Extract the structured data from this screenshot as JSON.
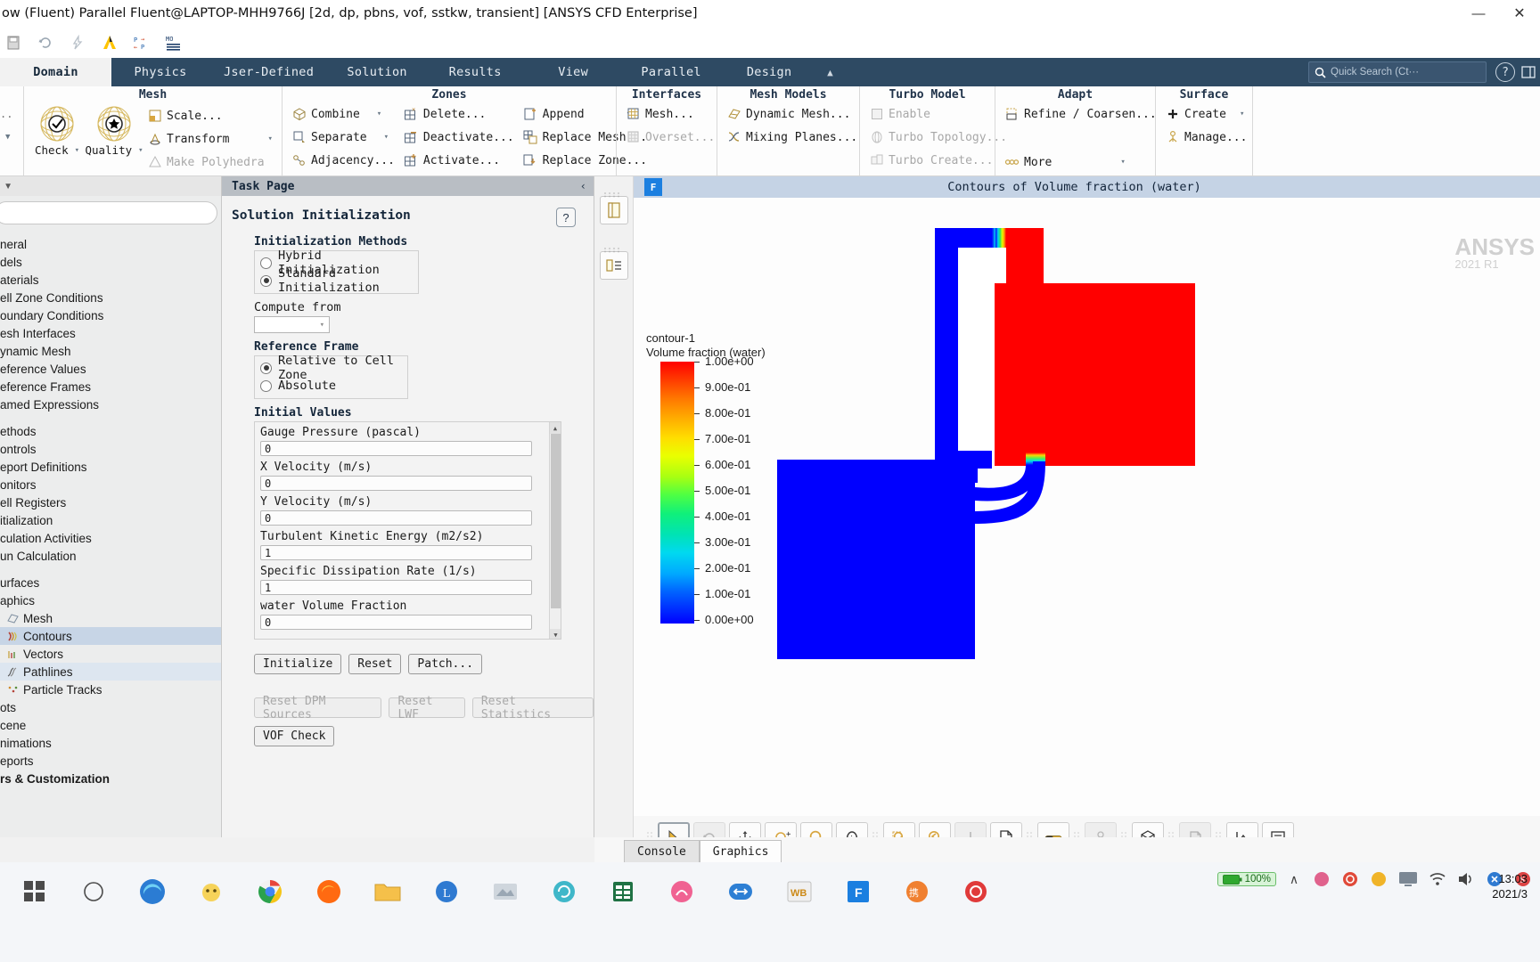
{
  "window": {
    "title": "ow (Fluent) Parallel Fluent@LAPTOP-MHH9766J  [2d, dp, pbns, vof, sstkw, transient] [ANSYS CFD Enterprise]",
    "minimize": "—",
    "maximize": "❐",
    "close": "✕"
  },
  "quick_access": [
    {
      "name": "save-icon",
      "glyph": "὚B"
    },
    {
      "name": "refresh-icon",
      "glyph": "↻"
    },
    {
      "name": "lightning-icon",
      "glyph": "⚡"
    },
    {
      "name": "ansys-logo-icon",
      "glyph": "Λ"
    },
    {
      "name": "pressure-icon",
      "glyph": "P"
    },
    {
      "name": "mo-icon",
      "glyph": "MO"
    }
  ],
  "ribbon": {
    "tabs": [
      {
        "label": "Domain",
        "active": true
      },
      {
        "label": "Physics",
        "active": false
      },
      {
        "label": "Jser-Defined",
        "active": false
      },
      {
        "label": "Solution",
        "active": false
      },
      {
        "label": "Results",
        "active": false
      },
      {
        "label": "View",
        "active": false
      },
      {
        "label": "Parallel",
        "active": false
      },
      {
        "label": "Design",
        "active": false
      }
    ],
    "collapse_caret": "▲",
    "search": {
      "placeholder": "Quick Search (Ct···",
      "icon": "search-icon"
    },
    "help_label": "?",
    "groups": [
      {
        "title": "Mesh",
        "big_buttons": [
          {
            "label": "Check",
            "caret": "▾",
            "icon": "mesh-check-icon"
          },
          {
            "label": "Quality",
            "caret": "▾",
            "icon": "mesh-quality-icon"
          }
        ],
        "items": [
          {
            "label": "Scale...",
            "icon": "scale-icon",
            "disabled": false,
            "caret": ""
          },
          {
            "label": "Transform",
            "icon": "transform-icon",
            "disabled": false,
            "caret": "▾"
          },
          {
            "label": "Make Polyhedra",
            "icon": "polyhedra-icon",
            "disabled": true,
            "caret": ""
          }
        ]
      },
      {
        "title": "Zones",
        "items_col1": [
          {
            "label": "Combine",
            "icon": "combine-icon",
            "disabled": false,
            "caret": "▾"
          },
          {
            "label": "Separate",
            "icon": "separate-icon",
            "disabled": false,
            "caret": "▾"
          },
          {
            "label": "Adjacency...",
            "icon": "adjacency-icon",
            "disabled": false,
            "caret": ""
          }
        ],
        "items_col2": [
          {
            "label": "Delete...",
            "icon": "delete-zone-icon",
            "disabled": false,
            "caret": ""
          },
          {
            "label": "Deactivate...",
            "icon": "deactivate-zone-icon",
            "disabled": false,
            "caret": ""
          },
          {
            "label": "Activate...",
            "icon": "activate-zone-icon",
            "disabled": false,
            "caret": ""
          }
        ],
        "items_col3": [
          {
            "label": "Append",
            "icon": "append-icon",
            "disabled": false,
            "caret": "▾"
          },
          {
            "label": "Replace Mesh...",
            "icon": "replace-mesh-icon",
            "disabled": false,
            "caret": ""
          },
          {
            "label": "Replace Zone...",
            "icon": "replace-zone-icon",
            "disabled": false,
            "caret": ""
          }
        ]
      },
      {
        "title": "Interfaces",
        "items": [
          {
            "label": "Mesh...",
            "icon": "interface-mesh-icon",
            "disabled": false,
            "caret": ""
          },
          {
            "label": "Overset...",
            "icon": "overset-icon",
            "disabled": true,
            "caret": ""
          }
        ]
      },
      {
        "title": "Mesh Models",
        "items": [
          {
            "label": "Dynamic Mesh...",
            "icon": "dynamic-mesh-icon",
            "disabled": false,
            "caret": ""
          },
          {
            "label": "Mixing Planes...",
            "icon": "mixing-planes-icon",
            "disabled": false,
            "caret": ""
          }
        ]
      },
      {
        "title": "Turbo Model",
        "items": [
          {
            "label": "Enable",
            "icon": "turbo-enable-icon",
            "disabled": true,
            "caret": ""
          },
          {
            "label": "Turbo Topology...",
            "icon": "turbo-topology-icon",
            "disabled": true,
            "caret": ""
          },
          {
            "label": "Turbo Create...",
            "icon": "turbo-create-icon",
            "disabled": true,
            "caret": ""
          }
        ]
      },
      {
        "title": "Adapt",
        "items": [
          {
            "label": "Refine / Coarsen...",
            "icon": "refine-coarsen-icon",
            "disabled": false,
            "caret": ""
          },
          {
            "label": "More",
            "icon": "more-icon",
            "disabled": false,
            "caret": "▾"
          }
        ]
      },
      {
        "title": "Surface",
        "items": [
          {
            "label": "Create",
            "icon": "create-surface-icon",
            "disabled": false,
            "caret": "▾"
          },
          {
            "label": "Manage...",
            "icon": "manage-surface-icon",
            "disabled": false,
            "caret": ""
          }
        ]
      }
    ]
  },
  "tree": {
    "items": [
      {
        "label": "neral",
        "icon": "",
        "state": "normal"
      },
      {
        "label": "dels",
        "icon": "",
        "state": "normal"
      },
      {
        "label": "aterials",
        "icon": "",
        "state": "normal"
      },
      {
        "label": "ell Zone Conditions",
        "icon": "",
        "state": "normal"
      },
      {
        "label": "oundary Conditions",
        "icon": "",
        "state": "normal"
      },
      {
        "label": "esh Interfaces",
        "icon": "",
        "state": "normal"
      },
      {
        "label": "ynamic Mesh",
        "icon": "",
        "state": "normal"
      },
      {
        "label": "eference Values",
        "icon": "",
        "state": "normal"
      },
      {
        "label": "eference Frames",
        "icon": "",
        "state": "normal"
      },
      {
        "label": "amed Expressions",
        "icon": "",
        "state": "normal"
      },
      {
        "label": "GAP",
        "icon": "",
        "state": "gap"
      },
      {
        "label": "ethods",
        "icon": "",
        "state": "normal"
      },
      {
        "label": "ontrols",
        "icon": "",
        "state": "normal"
      },
      {
        "label": "eport Definitions",
        "icon": "",
        "state": "normal"
      },
      {
        "label": "onitors",
        "icon": "",
        "state": "normal"
      },
      {
        "label": "ell Registers",
        "icon": "",
        "state": "normal"
      },
      {
        "label": "itialization",
        "icon": "",
        "state": "normal"
      },
      {
        "label": "culation Activities",
        "icon": "",
        "state": "normal"
      },
      {
        "label": "un Calculation",
        "icon": "",
        "state": "normal"
      },
      {
        "label": "GAP",
        "icon": "",
        "state": "gap"
      },
      {
        "label": "urfaces",
        "icon": "",
        "state": "normal"
      },
      {
        "label": "aphics",
        "icon": "",
        "state": "normal"
      },
      {
        "label": "Mesh",
        "icon": "mesh-tree-icon",
        "state": "child"
      },
      {
        "label": "Contours",
        "icon": "contours-tree-icon",
        "state": "selected"
      },
      {
        "label": "Vectors",
        "icon": "vectors-tree-icon",
        "state": "child"
      },
      {
        "label": "Pathlines",
        "icon": "pathlines-tree-icon",
        "state": "hover"
      },
      {
        "label": "Particle Tracks",
        "icon": "particle-tracks-tree-icon",
        "state": "child"
      },
      {
        "label": "ots",
        "icon": "",
        "state": "normal"
      },
      {
        "label": "cene",
        "icon": "",
        "state": "normal"
      },
      {
        "label": "nimations",
        "icon": "",
        "state": "normal"
      },
      {
        "label": "eports",
        "icon": "",
        "state": "normal"
      },
      {
        "label": "rs & Customization",
        "icon": "",
        "state": "bold"
      }
    ]
  },
  "task_page": {
    "header": "Task Page",
    "collapse_chevron": "‹",
    "title": "Solution Initialization",
    "help_label": "?",
    "init_methods": {
      "group_label": "Initialization Methods",
      "options": [
        {
          "label": "Hybrid  Initialization",
          "selected": false
        },
        {
          "label": "Standard Initialization",
          "selected": true
        }
      ]
    },
    "compute_from": {
      "label": "Compute from",
      "value": "",
      "caret": "▾"
    },
    "reference_frame": {
      "group_label": "Reference Frame",
      "options": [
        {
          "label": "Relative to Cell Zone",
          "selected": true
        },
        {
          "label": "Absolute",
          "selected": false
        }
      ]
    },
    "initial_values": {
      "group_label": "Initial Values",
      "fields": [
        {
          "label": "Gauge Pressure (pascal)",
          "value": "0"
        },
        {
          "label": "X Velocity (m/s)",
          "value": "0"
        },
        {
          "label": "Y Velocity (m/s)",
          "value": "0"
        },
        {
          "label": "Turbulent Kinetic Energy (m2/s2)",
          "value": "1"
        },
        {
          "label": "Specific Dissipation Rate (1/s)",
          "value": "1"
        },
        {
          "label": "water Volume Fraction",
          "value": "0"
        }
      ]
    },
    "buttons_primary": [
      {
        "label": "Initialize",
        "disabled": false
      },
      {
        "label": "Reset",
        "disabled": false
      },
      {
        "label": "Patch...",
        "disabled": false
      }
    ],
    "buttons_reset": [
      {
        "label": "Reset DPM Sources",
        "disabled": true
      },
      {
        "label": "Reset LWF",
        "disabled": true
      },
      {
        "label": "Reset Statistics",
        "disabled": true
      }
    ],
    "buttons_vof": [
      {
        "label": "VOF Check",
        "disabled": false
      }
    ]
  },
  "graphics": {
    "tag": "F",
    "title": "Contours of Volume fraction (water)",
    "watermark": "ANSYS",
    "watermark_sub": "2021 R1",
    "dock_buttons": [
      {
        "name": "single-pane-icon"
      },
      {
        "name": "split-pane-icon"
      }
    ],
    "toolbar": [
      {
        "name": "select-tool-icon",
        "state": "selected"
      },
      {
        "name": "rotate-tool-icon",
        "state": "disabled"
      },
      {
        "name": "pan-tool-icon",
        "state": "normal"
      },
      {
        "name": "zoom-inout-tool-icon",
        "state": "normal"
      },
      {
        "name": "zoom-tool-icon",
        "state": "normal"
      },
      {
        "name": "probe-info-icon",
        "state": "normal"
      },
      {
        "name": "zoom-to-fit-icon",
        "state": "normal"
      },
      {
        "name": "zoom-previous-icon",
        "state": "normal"
      },
      {
        "name": "axes-tool-icon",
        "state": "disabled"
      },
      {
        "name": "save-picture-icon",
        "state": "normal"
      },
      {
        "name": "colormap-icon",
        "state": "normal"
      },
      {
        "name": "lights-icon",
        "state": "disabled"
      },
      {
        "name": "view-cube-icon",
        "state": "normal"
      },
      {
        "name": "clip-plane-icon",
        "state": "disabled"
      },
      {
        "name": "orientation-icon",
        "state": "normal"
      },
      {
        "name": "panel-list-icon",
        "state": "normal"
      }
    ]
  },
  "chart_data": {
    "type": "heatmap",
    "title": "Contours of Volume fraction (water)",
    "legend_title_line1": "contour-1",
    "legend_title_line2": "Volume fraction (water)",
    "colorbar": {
      "min": 0,
      "max": 1,
      "ticks": [
        "1.00e+00",
        "9.00e-01",
        "8.00e-01",
        "7.00e-01",
        "6.00e-01",
        "5.00e-01",
        "4.00e-01",
        "3.00e-01",
        "2.00e-01",
        "1.00e-01",
        "0.00e+00"
      ],
      "tick_values": [
        1.0,
        0.9,
        0.8,
        0.7,
        0.6,
        0.5,
        0.4,
        0.3,
        0.2,
        0.1,
        0.0
      ],
      "colormap": "rainbow-blue-to-red"
    },
    "regions": [
      {
        "name": "upper-left-duct",
        "color": "#0000ff",
        "value": 0.0
      },
      {
        "name": "upper-right-tank",
        "color": "#ff0000",
        "value": 1.0
      },
      {
        "name": "interface-band",
        "color": "gradient",
        "value": 0.5
      },
      {
        "name": "lower-left-reservoir",
        "color": "#0000ff",
        "value": 0.0
      },
      {
        "name": "connecting-pipe",
        "color": "#0000ff",
        "value": 0.0
      }
    ]
  },
  "bottom_tabs": [
    {
      "label": "Console",
      "active": false
    },
    {
      "label": "Graphics",
      "active": true
    }
  ],
  "taskbar": {
    "apps": [
      {
        "name": "start-icon"
      },
      {
        "name": "cortana-icon"
      },
      {
        "name": "edge-icon"
      },
      {
        "name": "app-yellow-icon"
      },
      {
        "name": "chrome-icon"
      },
      {
        "name": "firefox-icon"
      },
      {
        "name": "explorer-icon"
      },
      {
        "name": "app-blue-l-icon"
      },
      {
        "name": "app-gray-icon"
      },
      {
        "name": "app-teal-icon"
      },
      {
        "name": "excel-icon"
      },
      {
        "name": "app-pink-icon"
      },
      {
        "name": "app-arrows-icon"
      },
      {
        "name": "workbench-icon"
      },
      {
        "name": "fluent-icon"
      },
      {
        "name": "app-orange-icon"
      },
      {
        "name": "app-red-icon"
      }
    ],
    "battery_percent": "100%",
    "tray": [
      {
        "name": "chevron-up-icon",
        "glyph": "∧"
      },
      {
        "name": "tray-pink-icon"
      },
      {
        "name": "tray-red-icon"
      },
      {
        "name": "tray-yellow-icon"
      },
      {
        "name": "tray-monitor-icon"
      },
      {
        "name": "tray-wifi-icon"
      },
      {
        "name": "tray-volume-icon"
      },
      {
        "name": "tray-blue-icon"
      },
      {
        "name": "tray-s-icon"
      }
    ],
    "clock_time": "13:03",
    "clock_date": "2021/3"
  }
}
